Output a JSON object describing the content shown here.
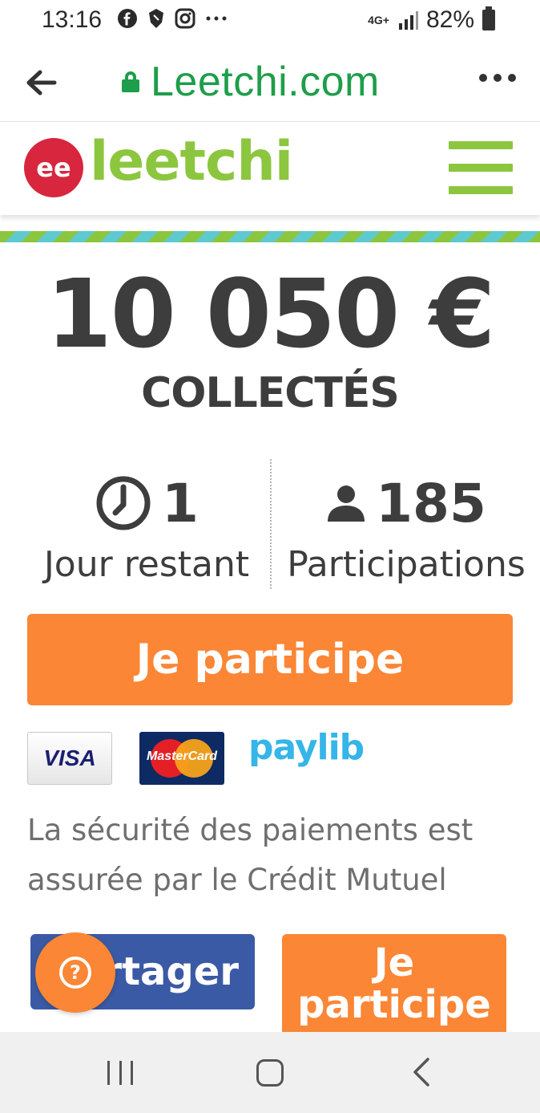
{
  "status_bar": {
    "time": "13:16",
    "network": "4G+",
    "battery": "82%"
  },
  "browser": {
    "url": "Leetchi.com"
  },
  "site": {
    "logo_mark": "ee",
    "logo_text": "leetchi",
    "brand_green": "#8cc63f",
    "accent_orange": "#fb8635"
  },
  "campaign": {
    "amount": "10 050 €",
    "amount_label": "COLLECTÉS",
    "days_value": "1",
    "days_label": "Jour restant",
    "participants_value": "185",
    "participants_label": "Participations"
  },
  "actions": {
    "participate_label": "Je participe",
    "share_label": "rtager",
    "participate_secondary_label": "Je participe"
  },
  "payment": {
    "visa": "VISA",
    "mastercard": "MasterCard",
    "paylib": "paylib",
    "security_text": "La sécurité des paiements est assurée par le Crédit Mutuel"
  },
  "help": {
    "icon_glyph": "?"
  }
}
